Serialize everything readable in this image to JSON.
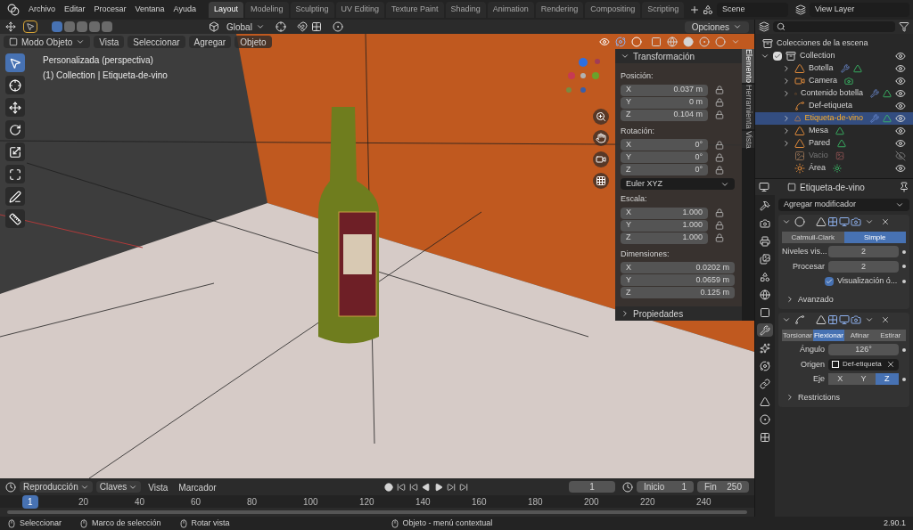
{
  "menu_bar": {
    "items": [
      "Archivo",
      "Editar",
      "Procesar",
      "Ventana",
      "Ayuda"
    ]
  },
  "workspaces": [
    {
      "label": "Layout",
      "selected": true
    },
    {
      "label": "Modeling",
      "selected": false
    },
    {
      "label": "Sculpting",
      "selected": false
    },
    {
      "label": "UV Editing",
      "selected": false
    },
    {
      "label": "Texture Paint",
      "selected": false
    },
    {
      "label": "Shading",
      "selected": false
    },
    {
      "label": "Animation",
      "selected": false
    },
    {
      "label": "Rendering",
      "selected": false
    },
    {
      "label": "Compositing",
      "selected": false
    },
    {
      "label": "Scripting",
      "selected": false
    }
  ],
  "scene": "Scene",
  "view_layer": "View Layer",
  "tool_header": {
    "orientation": "Global",
    "options": "Opciones"
  },
  "viewport_header": {
    "mode": "Modo Objeto",
    "menus": [
      "Vista",
      "Seleccionar",
      "Agregar",
      "Objeto"
    ]
  },
  "tools": [
    {
      "kind": "select",
      "selected": true
    },
    {
      "kind": "cursor",
      "selected": false
    },
    {
      "kind": "move",
      "selected": false
    },
    {
      "kind": "rotate",
      "selected": false
    },
    {
      "kind": "scale",
      "selected": false
    },
    {
      "kind": "transform",
      "selected": false
    },
    {
      "kind": "annotate",
      "selected": false
    },
    {
      "kind": "measure",
      "selected": false
    }
  ],
  "viewport_info": [
    "Personalizada (perspectiva)",
    "(1) Collection | Etiqueta-de-vino"
  ],
  "n_panel": {
    "title": "Transformación",
    "groups": [
      {
        "label": "Posición:",
        "lockable": true,
        "fields": [
          {
            "axis": "X",
            "value": "0.037 m"
          },
          {
            "axis": "Y",
            "value": "0 m"
          },
          {
            "axis": "Z",
            "value": "0.104 m"
          }
        ]
      },
      {
        "label": "Rotación:",
        "lockable": true,
        "fields": [
          {
            "axis": "X",
            "value": "0°"
          },
          {
            "axis": "Y",
            "value": "0°"
          },
          {
            "axis": "Z",
            "value": "0°"
          }
        ],
        "mode": "Euler XYZ"
      },
      {
        "label": "Escala:",
        "lockable": true,
        "fields": [
          {
            "axis": "X",
            "value": "1.000"
          },
          {
            "axis": "Y",
            "value": "1.000"
          },
          {
            "axis": "Z",
            "value": "1.000"
          }
        ]
      },
      {
        "label": "Dimensiones:",
        "lockable": false,
        "fields": [
          {
            "axis": "X",
            "value": "0.0202 m"
          },
          {
            "axis": "Y",
            "value": "0.0659 m"
          },
          {
            "axis": "Z",
            "value": "0.125 m"
          }
        ]
      }
    ],
    "collapsed_title": "Propiedades",
    "tabs": [
      {
        "label": "Elemento",
        "selected": true
      },
      {
        "label": "Herramienta",
        "selected": false
      },
      {
        "label": "Vista",
        "selected": false
      }
    ]
  },
  "outliner": {
    "title": "Colecciones de la escena",
    "children": [
      {
        "label": "Collection",
        "checked": true,
        "expanded": true,
        "children": [
          {
            "label": "Botella",
            "kind": "mesh",
            "expanded": false,
            "selected": false,
            "disabled": false,
            "visible": true,
            "has_modifier": true
          },
          {
            "label": "Camera",
            "kind": "camera",
            "expanded": false,
            "selected": false,
            "disabled": false,
            "visible": true,
            "has_modifier": false
          },
          {
            "label": "Contenido botella",
            "kind": "mesh",
            "expanded": false,
            "selected": false,
            "disabled": false,
            "visible": true,
            "has_modifier": true
          },
          {
            "label": "Def-etiqueta",
            "kind": "empty",
            "selected": false,
            "disabled": false,
            "visible": true,
            "has_modifier": false
          },
          {
            "label": "Etiqueta-de-vino",
            "kind": "mesh",
            "expanded": false,
            "selected": true,
            "disabled": false,
            "visible": true,
            "has_modifier": true
          },
          {
            "label": "Mesa",
            "kind": "mesh",
            "expanded": false,
            "selected": false,
            "disabled": false,
            "visible": true,
            "has_modifier": false
          },
          {
            "label": "Pared",
            "kind": "mesh",
            "expanded": false,
            "selected": false,
            "disabled": false,
            "visible": true,
            "has_modifier": false
          },
          {
            "label": "Vacio",
            "kind": "image",
            "selected": false,
            "disabled": true,
            "visible": false,
            "has_modifier": false
          },
          {
            "label": "Área",
            "kind": "light",
            "selected": false,
            "disabled": false,
            "visible": true,
            "has_modifier": false
          }
        ]
      }
    ]
  },
  "properties": {
    "object": "Etiqueta-de-vino",
    "add_modifier": "Agregar modificador",
    "tabs": [
      {
        "kind": "tool",
        "selected": false
      },
      {
        "kind": "render",
        "selected": false
      },
      {
        "kind": "output",
        "selected": false
      },
      {
        "kind": "view_layer",
        "selected": false
      },
      {
        "kind": "scene",
        "selected": false
      },
      {
        "kind": "world",
        "selected": false
      },
      {
        "kind": "object",
        "selected": false
      },
      {
        "kind": "modifiers",
        "selected": true
      },
      {
        "kind": "particles",
        "selected": false
      },
      {
        "kind": "physics",
        "selected": false
      },
      {
        "kind": "constraints",
        "selected": false
      },
      {
        "kind": "data",
        "selected": false
      },
      {
        "kind": "material",
        "selected": false
      },
      {
        "kind": "texture",
        "selected": false
      }
    ],
    "modifiers": [
      {
        "kind": "subdivision",
        "expanded": true,
        "types": [
          {
            "label": "Catmull-Clark",
            "selected": false
          },
          {
            "label": "Simple",
            "selected": true
          }
        ],
        "fields": [
          {
            "label": "Niveles vis...",
            "value": "2"
          },
          {
            "label": "Procesar",
            "value": "2"
          }
        ],
        "checkbox": {
          "label": "Visualización ó...",
          "checked": true
        },
        "subpanel": "Avanzado"
      },
      {
        "kind": "deform",
        "expanded": true,
        "types": [
          {
            "label": "Torsionar",
            "selected": false
          },
          {
            "label": "Flexionar",
            "selected": true
          },
          {
            "label": "Afinar",
            "selected": false
          },
          {
            "label": "Estirar",
            "selected": false
          }
        ],
        "fields": [
          {
            "label": "Ángulo",
            "value": "126°"
          }
        ],
        "origin": {
          "label": "Origen",
          "value": "Def-etiqueta"
        },
        "axis": {
          "label": "Eje",
          "options": [
            {
              "label": "X",
              "selected": false
            },
            {
              "label": "Y",
              "selected": false
            },
            {
              "label": "Z",
              "selected": true
            }
          ]
        },
        "subpanel": "Restrictions"
      }
    ]
  },
  "timeline": {
    "menus": [
      {
        "label": "Reproducción",
        "dropdown": true
      },
      {
        "label": "Claves",
        "dropdown": true
      },
      {
        "label": "Vista",
        "dropdown": false
      },
      {
        "label": "Marcador",
        "dropdown": false
      }
    ],
    "current_frame": "1",
    "start_label": "Inicio",
    "start": "1",
    "end_label": "Fin",
    "end": "250",
    "ruler": [
      {
        "label": "1",
        "current": true
      },
      {
        "label": "20",
        "current": false
      },
      {
        "label": "40",
        "current": false
      },
      {
        "label": "60",
        "current": false
      },
      {
        "label": "80",
        "current": false
      },
      {
        "label": "100",
        "current": false
      },
      {
        "label": "120",
        "current": false
      },
      {
        "label": "140",
        "current": false
      },
      {
        "label": "160",
        "current": false
      },
      {
        "label": "180",
        "current": false
      },
      {
        "label": "200",
        "current": false
      },
      {
        "label": "220",
        "current": false
      },
      {
        "label": "240",
        "current": false
      }
    ]
  },
  "status_bar": {
    "hints": [
      "Seleccionar",
      "Marco de selección",
      "Rotar vista",
      "Objeto - menú contextual"
    ],
    "version": "2.90.1"
  }
}
